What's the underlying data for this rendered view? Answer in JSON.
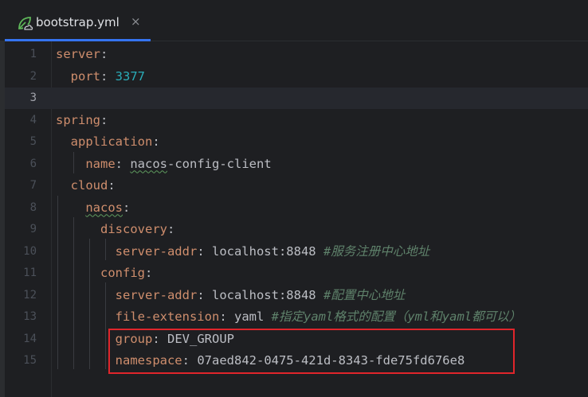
{
  "tab": {
    "icon": "spring-leaf-icon",
    "label": "bootstrap.yml",
    "close_glyph": "×"
  },
  "lines": [
    {
      "num": "1",
      "parts": [
        {
          "t": "server",
          "c": "key"
        },
        {
          "t": ":",
          "c": "val"
        }
      ]
    },
    {
      "num": "2",
      "parts": [
        {
          "t": "  "
        },
        {
          "t": "port",
          "c": "key"
        },
        {
          "t": ": ",
          "c": "val"
        },
        {
          "t": "3377",
          "c": "num"
        }
      ]
    },
    {
      "num": "3",
      "parts": [],
      "current": true
    },
    {
      "num": "4",
      "parts": [
        {
          "t": "spring",
          "c": "key"
        },
        {
          "t": ":",
          "c": "val"
        }
      ]
    },
    {
      "num": "5",
      "parts": [
        {
          "t": "  "
        },
        {
          "t": "application",
          "c": "key"
        },
        {
          "t": ":",
          "c": "val"
        }
      ]
    },
    {
      "num": "6",
      "parts": [
        {
          "t": "    "
        },
        {
          "t": "name",
          "c": "key"
        },
        {
          "t": ": ",
          "c": "val"
        },
        {
          "t": "nacos",
          "c": "val typo"
        },
        {
          "t": "-config-client",
          "c": "val"
        }
      ]
    },
    {
      "num": "7",
      "parts": [
        {
          "t": "  "
        },
        {
          "t": "cloud",
          "c": "key"
        },
        {
          "t": ":",
          "c": "val"
        }
      ]
    },
    {
      "num": "8",
      "parts": [
        {
          "t": "    "
        },
        {
          "t": "nacos",
          "c": "key typo"
        },
        {
          "t": ":",
          "c": "val"
        }
      ]
    },
    {
      "num": "9",
      "parts": [
        {
          "t": "      "
        },
        {
          "t": "discovery",
          "c": "key"
        },
        {
          "t": ":",
          "c": "val"
        }
      ]
    },
    {
      "num": "10",
      "parts": [
        {
          "t": "        "
        },
        {
          "t": "server-addr",
          "c": "key"
        },
        {
          "t": ": ",
          "c": "val"
        },
        {
          "t": "localhost:8848 ",
          "c": "val"
        },
        {
          "t": "#服务注册中心地址",
          "c": "cmt"
        }
      ]
    },
    {
      "num": "11",
      "parts": [
        {
          "t": "      "
        },
        {
          "t": "config",
          "c": "key"
        },
        {
          "t": ":",
          "c": "val"
        }
      ]
    },
    {
      "num": "12",
      "parts": [
        {
          "t": "        "
        },
        {
          "t": "server-addr",
          "c": "key"
        },
        {
          "t": ": ",
          "c": "val"
        },
        {
          "t": "localhost:8848 ",
          "c": "val"
        },
        {
          "t": "#配置中心地址",
          "c": "cmt"
        }
      ]
    },
    {
      "num": "13",
      "parts": [
        {
          "t": "        "
        },
        {
          "t": "file-extension",
          "c": "key"
        },
        {
          "t": ": ",
          "c": "val"
        },
        {
          "t": "yaml ",
          "c": "val"
        },
        {
          "t": "#指定yaml格式的配置（yml和yaml都可以）",
          "c": "cmt"
        }
      ]
    },
    {
      "num": "14",
      "parts": [
        {
          "t": "        "
        },
        {
          "t": "group",
          "c": "key"
        },
        {
          "t": ": ",
          "c": "val"
        },
        {
          "t": "DEV_GROUP",
          "c": "val"
        }
      ]
    },
    {
      "num": "15",
      "parts": [
        {
          "t": "        "
        },
        {
          "t": "namespace",
          "c": "key"
        },
        {
          "t": ": ",
          "c": "val"
        },
        {
          "t": "07aed842-0475-421d-8343-fde75fd676e8",
          "c": "val"
        }
      ]
    }
  ],
  "colors": {
    "key": "#cf8e6d",
    "number": "#2aacb8",
    "comment": "#5f826b",
    "text": "#bcbec4",
    "highlight_box": "#e0252b",
    "tab_underline": "#3574f0"
  }
}
